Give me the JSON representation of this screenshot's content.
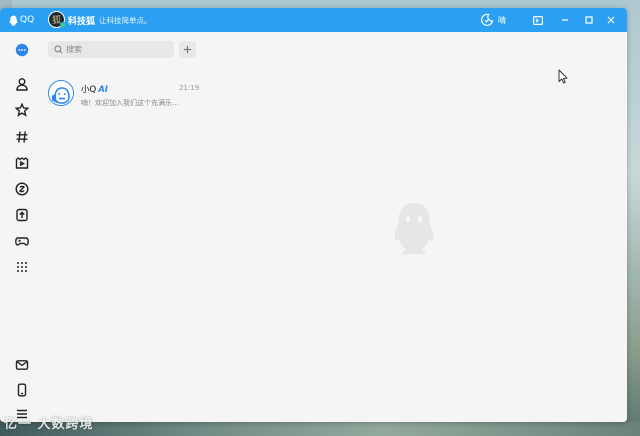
{
  "titlebar": {
    "app_name": "QQ",
    "avatar_glyph": "狐",
    "username": "科技狐",
    "signature": "让科技简单点。",
    "weather": "晴",
    "accent_color": "#2ba0f3"
  },
  "sidebar": {
    "top_items": [
      {
        "name": "messages-icon",
        "active": true
      },
      {
        "name": "contacts-icon"
      },
      {
        "name": "favorites-icon"
      },
      {
        "name": "channels-icon"
      },
      {
        "name": "video-icon"
      },
      {
        "name": "games-icon"
      },
      {
        "name": "docs-icon"
      },
      {
        "name": "gamepad-icon"
      },
      {
        "name": "apps-grid-icon"
      }
    ],
    "bottom_items": [
      {
        "name": "mail-icon"
      },
      {
        "name": "phone-icon"
      },
      {
        "name": "menu-icon"
      }
    ]
  },
  "search": {
    "placeholder": "搜索"
  },
  "chats": [
    {
      "name": "小Q",
      "badge": "AI",
      "time": "21:19",
      "preview": "嗨！欢迎加入我们这个充满乐..."
    }
  ],
  "watermark": "亿一 大数跨境"
}
